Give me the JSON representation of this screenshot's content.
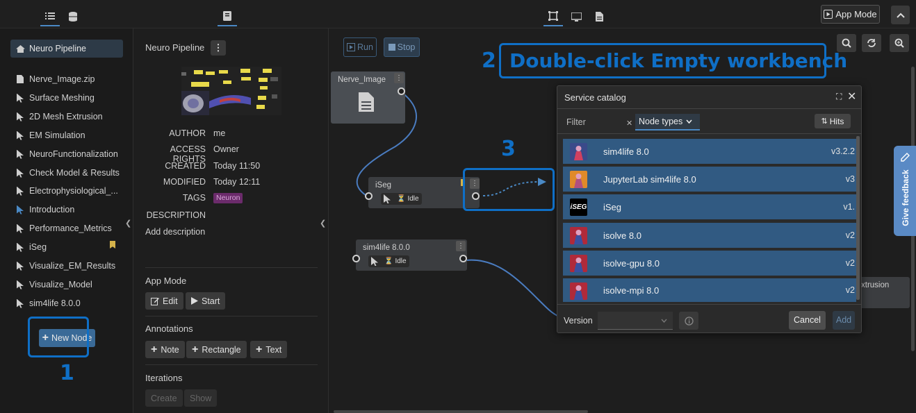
{
  "topbar": {
    "left_tabs": [
      "list-icon",
      "database-icon"
    ],
    "mid_tab": "book-icon",
    "view_tabs": [
      "workbench-icon",
      "monitor-icon",
      "document-icon"
    ],
    "app_mode_label": "App Mode"
  },
  "sidebar": {
    "root_label": "Neuro Pipeline",
    "items": [
      {
        "label": "Nerve_Image.zip",
        "icon": "file-icon"
      },
      {
        "label": "Surface Meshing",
        "icon": "cursor-icon"
      },
      {
        "label": "2D Mesh Extrusion",
        "icon": "cursor-icon"
      },
      {
        "label": "EM Simulation",
        "icon": "cursor-icon"
      },
      {
        "label": "NeuroFunctionalization",
        "icon": "cursor-icon"
      },
      {
        "label": "Check Model & Results",
        "icon": "cursor-icon"
      },
      {
        "label": "Electrophysiological_...",
        "icon": "cursor-icon"
      },
      {
        "label": "Introduction",
        "icon": "cursor-icon"
      },
      {
        "label": "Performance_Metrics",
        "icon": "cursor-icon"
      },
      {
        "label": "iSeg",
        "icon": "cursor-icon"
      },
      {
        "label": "Visualize_EM_Results",
        "icon": "cursor-icon"
      },
      {
        "label": "Visualize_Model",
        "icon": "cursor-icon"
      },
      {
        "label": "sim4life 8.0.0",
        "icon": "cursor-icon"
      }
    ],
    "new_node_label": "New Node"
  },
  "study": {
    "title": "Neuro Pipeline",
    "author_label": "AUTHOR",
    "author": "me",
    "access_label": "ACCESS RIGHTS",
    "access": "Owner",
    "created_label": "CREATED",
    "created": "Today 11:50",
    "modified_label": "MODIFIED",
    "modified": "Today 12:11",
    "tags_label": "TAGS",
    "tag": "Neuron",
    "description_label": "DESCRIPTION",
    "add_description": "Add description",
    "app_mode_title": "App Mode",
    "edit_label": "Edit",
    "start_label": "Start",
    "annotations_title": "Annotations",
    "note_label": "Note",
    "rectangle_label": "Rectangle",
    "text_label": "Text",
    "iterations_title": "Iterations",
    "create_label": "Create",
    "show_label": "Show"
  },
  "workbench": {
    "run_label": "Run",
    "stop_label": "Stop",
    "nodes": {
      "nerve": "Nerve_Image",
      "iseg": "iSeg",
      "sim4life": "sim4life 8.0.0",
      "extrusion": "xtrusion"
    },
    "idle_label": "Idle"
  },
  "catalog": {
    "title": "Service catalog",
    "filter_label": "Filter",
    "node_types_label": "Node types",
    "hits_label": "Hits",
    "rows": [
      {
        "name": "sim4life 8.0",
        "version": "v3.2.2",
        "thumb": "#3a4a8a"
      },
      {
        "name": "JupyterLab sim4life 8.0",
        "version": "v3",
        "thumb": "#e08a2a"
      },
      {
        "name": "iSeg",
        "version": "v1.",
        "thumb": "#000000"
      },
      {
        "name": "isolve 8.0",
        "version": "v2",
        "thumb": "#b02a3a"
      },
      {
        "name": "isolve-gpu 8.0",
        "version": "v2",
        "thumb": "#b02a3a"
      },
      {
        "name": "isolve-mpi 8.0",
        "version": "v2",
        "thumb": "#b02a3a"
      }
    ],
    "iseg_thumb_text": "iSEG",
    "version_label": "Version",
    "cancel_label": "Cancel",
    "add_label": "Add"
  },
  "feedback_label": "Give feedback",
  "annotations": {
    "one": "1",
    "two_num": "2",
    "two_text": "Double-click Empty workbench",
    "three": "3"
  },
  "colors": {
    "accent": "#0f6fc6",
    "row": "#315a82",
    "tag": "#6b2b6b"
  }
}
